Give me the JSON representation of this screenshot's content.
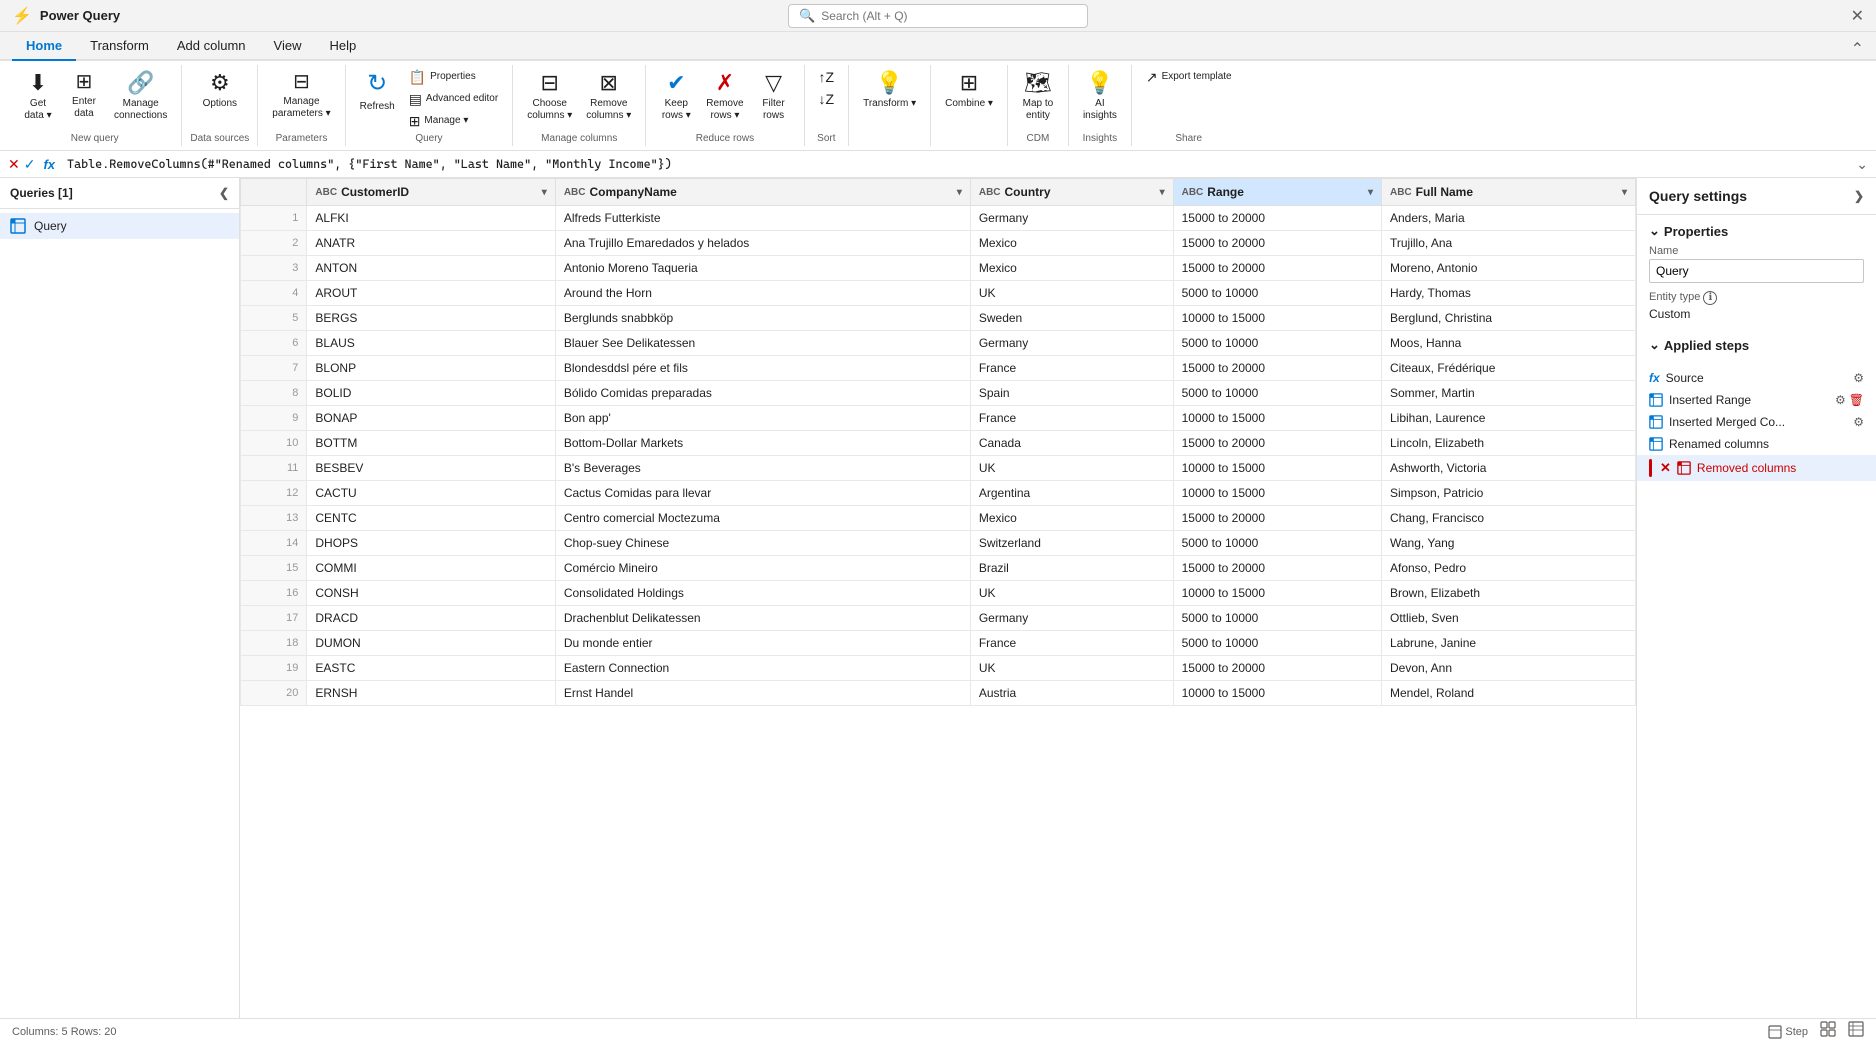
{
  "app": {
    "title": "Power Query",
    "close_label": "✕"
  },
  "search": {
    "placeholder": "Search (Alt + Q)"
  },
  "tabs": [
    {
      "label": "Home",
      "active": true
    },
    {
      "label": "Transform",
      "active": false
    },
    {
      "label": "Add column",
      "active": false
    },
    {
      "label": "View",
      "active": false
    },
    {
      "label": "Help",
      "active": false
    }
  ],
  "ribbon": {
    "groups": [
      {
        "name": "new-query",
        "label": "New query",
        "items": [
          {
            "id": "get-data",
            "icon": "⬇",
            "label": "Get\ndata ▾"
          },
          {
            "id": "enter-data",
            "icon": "⊞",
            "label": "Enter\ndata"
          },
          {
            "id": "manage-connections",
            "icon": "🔗",
            "label": "Manage\nconnections"
          }
        ]
      },
      {
        "name": "data-sources",
        "label": "Data sources",
        "items": [
          {
            "id": "options",
            "icon": "⚙",
            "label": "Options"
          }
        ]
      },
      {
        "name": "parameters",
        "label": "Parameters",
        "items": [
          {
            "id": "manage-parameters",
            "icon": "⊟",
            "label": "Manage\nparameters ▾"
          }
        ]
      },
      {
        "name": "query-group",
        "label": "Query",
        "items": [
          {
            "id": "refresh",
            "icon": "↻",
            "label": "Refresh"
          },
          {
            "id": "properties",
            "small": true,
            "icon": "📋",
            "label": "Properties"
          },
          {
            "id": "advanced-editor",
            "small": true,
            "icon": "▤",
            "label": "Advanced editor"
          },
          {
            "id": "manage",
            "small": true,
            "icon": "⊞",
            "label": "Manage ▾"
          }
        ]
      },
      {
        "name": "manage-columns",
        "label": "Manage columns",
        "items": [
          {
            "id": "choose-columns",
            "icon": "⊟",
            "label": "Choose\ncolumns ▾"
          },
          {
            "id": "remove-columns",
            "icon": "⊠",
            "label": "Remove\ncolumns ▾"
          }
        ]
      },
      {
        "name": "reduce-rows",
        "label": "Reduce rows",
        "items": [
          {
            "id": "keep-rows",
            "icon": "✔⊟",
            "label": "Keep\nrows ▾"
          },
          {
            "id": "remove-rows",
            "icon": "✗⊟",
            "label": "Remove\nrows ▾"
          },
          {
            "id": "filter-rows",
            "icon": "▽",
            "label": "Filter\nrows"
          }
        ]
      },
      {
        "name": "sort-group",
        "label": "Sort",
        "items": [
          {
            "id": "sort-asc",
            "icon": "↑Z",
            "label": ""
          },
          {
            "id": "sort-desc",
            "icon": "↓Z",
            "label": ""
          }
        ]
      },
      {
        "name": "transform-group",
        "label": "",
        "items": [
          {
            "id": "transform-btn",
            "icon": "💡",
            "label": "Transform ▾"
          }
        ]
      },
      {
        "name": "combine-group",
        "label": "",
        "items": [
          {
            "id": "combine-btn",
            "icon": "⊞",
            "label": "Combine ▾"
          }
        ]
      },
      {
        "name": "cdm-group",
        "label": "CDM",
        "items": [
          {
            "id": "map-to-entity",
            "icon": "🗺",
            "label": "Map to\nentity"
          }
        ]
      },
      {
        "name": "insights-group",
        "label": "Insights",
        "items": [
          {
            "id": "ai-insights",
            "icon": "💡",
            "label": "AI\ninsights"
          }
        ]
      },
      {
        "name": "share-group",
        "label": "Share",
        "items": [
          {
            "id": "export-template",
            "icon": "↗",
            "label": "Export template"
          }
        ]
      }
    ]
  },
  "formula_bar": {
    "cancel_icon": "✕",
    "confirm_icon": "✓",
    "fx_label": "fx",
    "formula": "Table.RemoveColumns(#\"Renamed columns\", {\"First Name\", \"Last Name\", \"Monthly Income\"})",
    "expand_icon": "⌄"
  },
  "queries_panel": {
    "title": "Queries [1]",
    "collapse_icon": "❮",
    "items": [
      {
        "id": "query1",
        "label": "Query",
        "selected": true
      }
    ]
  },
  "table": {
    "columns": [
      {
        "id": "customerid",
        "type": "ABC",
        "label": "CustomerID",
        "highlighted": false
      },
      {
        "id": "companyname",
        "type": "ABC",
        "label": "CompanyName",
        "highlighted": false
      },
      {
        "id": "country",
        "type": "ABC",
        "label": "Country",
        "highlighted": false
      },
      {
        "id": "range",
        "type": "ABC",
        "label": "Range",
        "highlighted": true
      },
      {
        "id": "fullname",
        "type": "ABC",
        "label": "Full Name",
        "highlighted": false
      }
    ],
    "rows": [
      {
        "num": 1,
        "customerid": "ALFKI",
        "companyname": "Alfreds Futterkiste",
        "country": "Germany",
        "range": "15000 to 20000",
        "fullname": "Anders, Maria"
      },
      {
        "num": 2,
        "customerid": "ANATR",
        "companyname": "Ana Trujillo Emaredados y helados",
        "country": "Mexico",
        "range": "15000 to 20000",
        "fullname": "Trujillo, Ana"
      },
      {
        "num": 3,
        "customerid": "ANTON",
        "companyname": "Antonio Moreno Taqueria",
        "country": "Mexico",
        "range": "15000 to 20000",
        "fullname": "Moreno, Antonio"
      },
      {
        "num": 4,
        "customerid": "AROUT",
        "companyname": "Around the Horn",
        "country": "UK",
        "range": "5000 to 10000",
        "fullname": "Hardy, Thomas"
      },
      {
        "num": 5,
        "customerid": "BERGS",
        "companyname": "Berglunds snabbköp",
        "country": "Sweden",
        "range": "10000 to 15000",
        "fullname": "Berglund, Christina"
      },
      {
        "num": 6,
        "customerid": "BLAUS",
        "companyname": "Blauer See Delikatessen",
        "country": "Germany",
        "range": "5000 to 10000",
        "fullname": "Moos, Hanna"
      },
      {
        "num": 7,
        "customerid": "BLONP",
        "companyname": "Blondesddsl pére et fils",
        "country": "France",
        "range": "15000 to 20000",
        "fullname": "Citeaux, Frédérique"
      },
      {
        "num": 8,
        "customerid": "BOLID",
        "companyname": "Bólido Comidas preparadas",
        "country": "Spain",
        "range": "5000 to 10000",
        "fullname": "Sommer, Martin"
      },
      {
        "num": 9,
        "customerid": "BONAP",
        "companyname": "Bon app'",
        "country": "France",
        "range": "10000 to 15000",
        "fullname": "Libihan, Laurence"
      },
      {
        "num": 10,
        "customerid": "BOTTM",
        "companyname": "Bottom-Dollar Markets",
        "country": "Canada",
        "range": "15000 to 20000",
        "fullname": "Lincoln, Elizabeth"
      },
      {
        "num": 11,
        "customerid": "BESBEV",
        "companyname": "B's Beverages",
        "country": "UK",
        "range": "10000 to 15000",
        "fullname": "Ashworth, Victoria"
      },
      {
        "num": 12,
        "customerid": "CACTU",
        "companyname": "Cactus Comidas para llevar",
        "country": "Argentina",
        "range": "10000 to 15000",
        "fullname": "Simpson, Patricio"
      },
      {
        "num": 13,
        "customerid": "CENTC",
        "companyname": "Centro comercial Moctezuma",
        "country": "Mexico",
        "range": "15000 to 20000",
        "fullname": "Chang, Francisco"
      },
      {
        "num": 14,
        "customerid": "DHOPS",
        "companyname": "Chop-suey Chinese",
        "country": "Switzerland",
        "range": "5000 to 10000",
        "fullname": "Wang, Yang"
      },
      {
        "num": 15,
        "customerid": "COMMI",
        "companyname": "Comércio Mineiro",
        "country": "Brazil",
        "range": "15000 to 20000",
        "fullname": "Afonso, Pedro"
      },
      {
        "num": 16,
        "customerid": "CONSH",
        "companyname": "Consolidated Holdings",
        "country": "UK",
        "range": "10000 to 15000",
        "fullname": "Brown, Elizabeth"
      },
      {
        "num": 17,
        "customerid": "DRACD",
        "companyname": "Drachenblut Delikatessen",
        "country": "Germany",
        "range": "5000 to 10000",
        "fullname": "Ottlieb, Sven"
      },
      {
        "num": 18,
        "customerid": "DUMON",
        "companyname": "Du monde entier",
        "country": "France",
        "range": "5000 to 10000",
        "fullname": "Labrune, Janine"
      },
      {
        "num": 19,
        "customerid": "EASTC",
        "companyname": "Eastern Connection",
        "country": "UK",
        "range": "15000 to 20000",
        "fullname": "Devon, Ann"
      },
      {
        "num": 20,
        "customerid": "ERNSH",
        "companyname": "Ernst Handel",
        "country": "Austria",
        "range": "10000 to 15000",
        "fullname": "Mendel, Roland"
      }
    ]
  },
  "settings_panel": {
    "title": "Query settings",
    "expand_icon": "❯",
    "properties_label": "Properties",
    "name_label": "Name",
    "name_value": "Query",
    "entity_type_label": "Entity type",
    "entity_type_info": "ℹ",
    "entity_type_value": "Custom",
    "applied_steps_label": "Applied steps",
    "steps": [
      {
        "id": "source",
        "icon": "fx",
        "label": "Source",
        "has_gear": true,
        "has_delete": false,
        "selected": false,
        "error": false
      },
      {
        "id": "inserted-range",
        "icon": "⊞",
        "label": "Inserted Range",
        "has_gear": true,
        "has_delete": true,
        "selected": false,
        "error": false
      },
      {
        "id": "inserted-merged",
        "icon": "⊞",
        "label": "Inserted Merged Co...",
        "has_gear": true,
        "has_delete": false,
        "selected": false,
        "error": false
      },
      {
        "id": "renamed-columns",
        "icon": "⊞",
        "label": "Renamed columns",
        "has_gear": false,
        "has_delete": false,
        "selected": false,
        "error": false
      },
      {
        "id": "removed-columns",
        "icon": "⊠",
        "label": "Removed columns",
        "has_gear": false,
        "has_delete": false,
        "selected": true,
        "error": true
      }
    ]
  },
  "status_bar": {
    "left": "Columns: 5    Rows: 20",
    "step_label": "Step",
    "diagram_icon": "⊞",
    "grid_icon": "⊟"
  }
}
